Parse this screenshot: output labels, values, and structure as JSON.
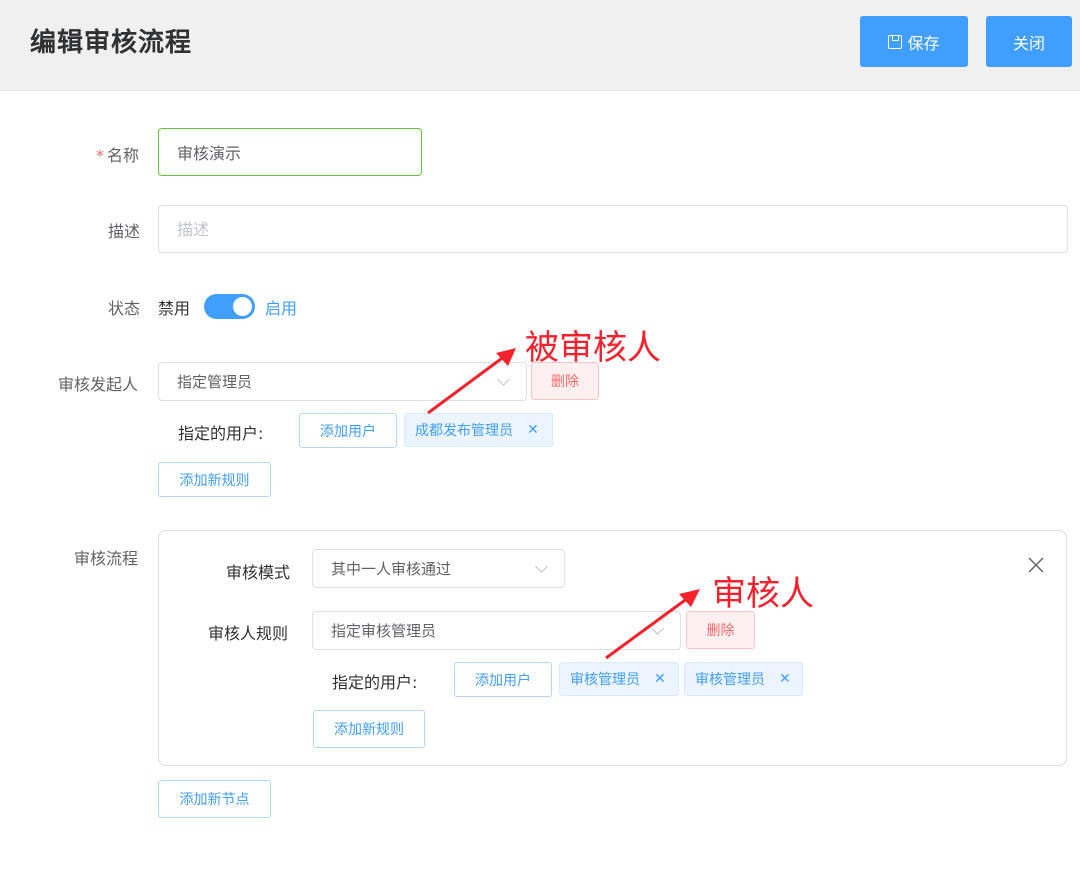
{
  "header": {
    "title": "编辑审核流程",
    "save_label": "保存",
    "close_label": "关闭"
  },
  "form": {
    "name": {
      "label": "名称",
      "required_mark": "*",
      "value": "审核演示"
    },
    "description": {
      "label": "描述",
      "placeholder": "描述",
      "value": ""
    },
    "status": {
      "label": "状态",
      "off_label": "禁用",
      "on_label": "启用",
      "enabled": true
    },
    "initiator": {
      "label": "审核发起人",
      "rule_select": "指定管理员",
      "delete_label": "删除",
      "assigned_label": "指定的用户:",
      "add_user_label": "添加用户",
      "users": [
        "成都发布管理员"
      ],
      "add_rule_label": "添加新规则"
    },
    "flow": {
      "label": "审核流程",
      "node": {
        "mode_label": "审核模式",
        "mode_value": "其中一人审核通过",
        "rule_label": "审核人规则",
        "rule_value": "指定审核管理员",
        "delete_label": "删除",
        "assigned_label": "指定的用户:",
        "add_user_label": "添加用户",
        "users": [
          "审核管理员",
          "审核管理员"
        ],
        "add_rule_label": "添加新规则"
      },
      "add_node_label": "添加新节点"
    }
  },
  "annotations": {
    "reviewee": "被审核人",
    "reviewer": "审核人"
  },
  "colors": {
    "primary": "#409eff",
    "danger": "#f56c6c",
    "success_border": "#67c23a",
    "annotation": "#f5222d"
  }
}
